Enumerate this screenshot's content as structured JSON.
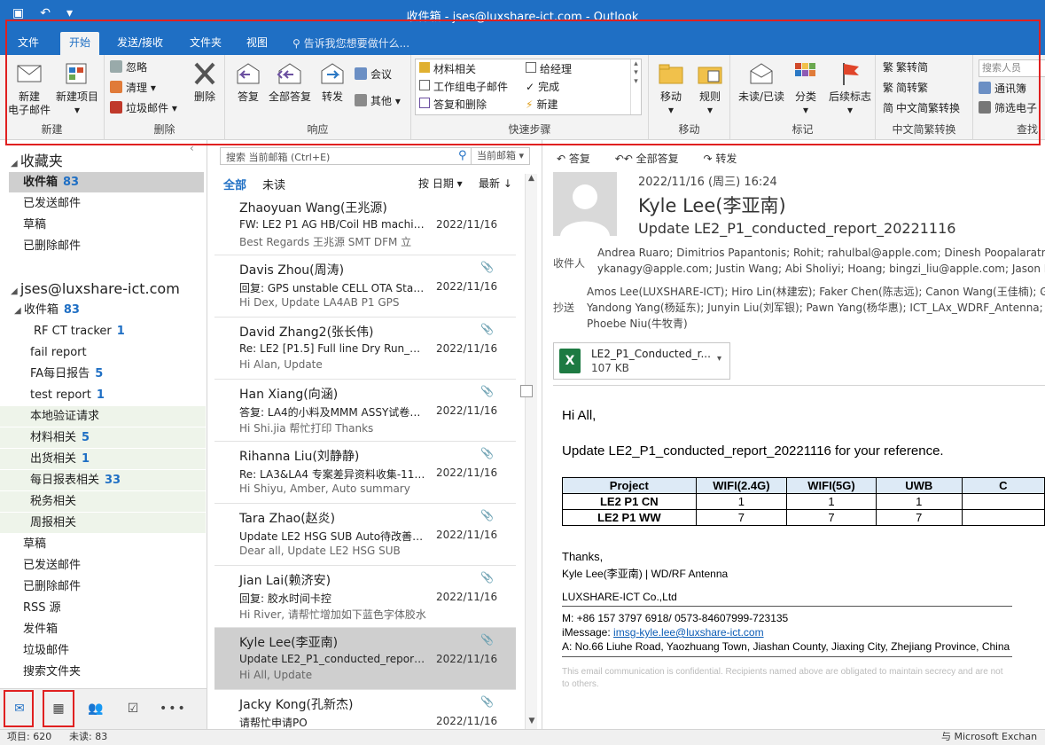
{
  "window": {
    "title": "收件箱 - jses@luxshare-ict.com - Outlook"
  },
  "menu": {
    "tabs": [
      "文件",
      "开始",
      "发送/接收",
      "文件夹",
      "视图"
    ],
    "tell_me": "告诉我您想要做什么..."
  },
  "ribbon": {
    "new_group": {
      "label": "新建",
      "new_email": "新建\n电子邮件",
      "new_items": "新建项目"
    },
    "delete_group": {
      "label": "删除",
      "ignore": "忽略",
      "cleanup": "清理",
      "junk": "垃圾邮件",
      "delete": "删除"
    },
    "respond_group": {
      "label": "响应",
      "reply": "答复",
      "reply_all": "全部答复",
      "forward": "转发",
      "meeting": "会议",
      "more": "其他"
    },
    "quick_steps": {
      "label": "快速步骤",
      "items": [
        "材料相关",
        "工作组电子邮件",
        "答复和删除",
        "给经理",
        "完成",
        "新建"
      ]
    },
    "move_group": {
      "label": "移动",
      "move": "移动",
      "rules": "规则"
    },
    "tags_group": {
      "label": "标记",
      "unread": "未读/已读",
      "categorize": "分类",
      "followup": "后续标志"
    },
    "convert_group": {
      "label": "中文简繁转换",
      "to_trad": "繁转简",
      "to_simp": "简转繁",
      "convert": "中文简繁转换"
    },
    "find_group": {
      "label": "查找",
      "search_people": "搜索人员",
      "address_book": "通讯簿",
      "filter": "筛选电子"
    }
  },
  "folders": {
    "favorites_header": "收藏夹",
    "favorites": [
      {
        "name": "收件箱",
        "count": "83"
      },
      {
        "name": "已发送邮件",
        "count": ""
      },
      {
        "name": "草稿",
        "count": ""
      },
      {
        "name": "已删除邮件",
        "count": ""
      }
    ],
    "account": "jses@luxshare-ict.com",
    "inbox": {
      "name": "收件箱",
      "count": "83"
    },
    "subfolders": [
      {
        "name": "RF CT tracker",
        "count": "1"
      },
      {
        "name": "fail report",
        "count": ""
      },
      {
        "name": "FA每日报告",
        "count": "5"
      },
      {
        "name": "test report",
        "count": "1"
      },
      {
        "name": "本地验证请求",
        "count": ""
      },
      {
        "name": "材料相关",
        "count": "5"
      },
      {
        "name": "出货相关",
        "count": "1"
      },
      {
        "name": "每日报表相关",
        "count": "33"
      },
      {
        "name": "税务相关",
        "count": ""
      },
      {
        "name": "周报相关",
        "count": ""
      }
    ],
    "others": [
      "草稿",
      "已发送邮件",
      "已删除邮件",
      "RSS 源",
      "发件箱",
      "垃圾邮件",
      "搜索文件夹"
    ]
  },
  "status": {
    "items": "项目: 620",
    "unread": "未读: 83",
    "server": "与 Microsoft Exchan"
  },
  "list": {
    "search_placeholder": "搜索 当前邮箱 (Ctrl+E)",
    "scope": "当前邮箱",
    "filter_all": "全部",
    "filter_unread": "未读",
    "sort_by": "按 日期",
    "order": "最新"
  },
  "messages": [
    {
      "from": "Zhaoyuan Wang(王兆源)",
      "subject": "FW: LE2 P1 AG HB/Coil HB machine...",
      "date": "2022/11/16",
      "preview": "Best Regards  王兆源  SMT DFM  立"
    },
    {
      "from": "Davis Zhou(周涛)",
      "subject": "回复: GPS unstable CELL OTA Statio...",
      "date": "2022/11/16",
      "preview": "Hi Dex,  Update LA4AB P1 GPS"
    },
    {
      "from": "David Zhang2(张长伟)",
      "subject": "Re: LE2 [P1.5] Full line Dry Run_221...",
      "date": "2022/11/16",
      "preview": "Hi Alan,  Update"
    },
    {
      "from": "Han Xiang(向涵)",
      "subject": "答复: LA4的小料及MMM ASSY试卷打...",
      "date": "2022/11/16",
      "preview": "Hi Shi.jia  帮忙打印  Thanks"
    },
    {
      "from": "Rihanna Liu(刘静静)",
      "subject": "Re: LA3&LA4 专案差异资料收集-11/16",
      "date": "2022/11/16",
      "preview": "Hi Shiyu, Amber,  Auto summary"
    },
    {
      "from": "Tara Zhao(赵炎)",
      "subject": "Update LE2 HSG SUB Auto待改善问...",
      "date": "2022/11/16",
      "preview": "Dear all,  Update LE2 HSG SUB"
    },
    {
      "from": "Jian Lai(赖济安)",
      "subject": "回复:  胶水时间卡控",
      "date": "2022/11/16",
      "preview": "Hi River,  请帮忙增加如下蓝色字体胶水"
    },
    {
      "from": "Kyle Lee(李亚南)",
      "subject": "Update LE2_P1_conducted_report_...",
      "date": "2022/11/16",
      "preview": "Hi All,  Update"
    },
    {
      "from": "Jacky Kong(孔新杰)",
      "subject": "请帮忙申请PO",
      "date": "2022/11/16",
      "preview": ""
    }
  ],
  "reading": {
    "actions": [
      "答复",
      "全部答复",
      "转发"
    ],
    "date": "2022/11/16 (周三) 16:24",
    "sender": "Kyle Lee(李亚南)",
    "subject": "Update LE2_P1_conducted_report_20221116",
    "to_label": "收件人",
    "to_line1": "Andrea Ruaro; Dimitrios Papantonis; Rohit; rahulbal@apple.com; Dinesh Poopalaratnam",
    "to_line2": "ykanagy@apple.com; Justin Wang; Abi Sholiyi; Hoang; bingzi_liu@apple.com; Jason Niu",
    "cc_label": "抄送",
    "cc_line1": "Amos Lee(LUXSHARE-ICT); Hiro Lin(林建宏); Faker Chen(陈志远); Canon Wang(王佳楠); Gez",
    "cc_line2": "Yandong Yang(杨延东); Junyin Liu(刘军银); Pawn Yang(杨华惠); ICT_LAx_WDRF_Antenna; IC",
    "cc_line3": "Phoebe Niu(牛牧青)",
    "attachment_name": "LE2_P1_Conducted_r...",
    "attachment_size": "107 KB",
    "greeting": "Hi All,",
    "body_line": "Update LE2_P1_conducted_report_20221116 for your reference.",
    "table": {
      "headers": [
        "Project",
        "WIFI(2.4G)",
        "WIFI(5G)",
        "UWB",
        "C"
      ],
      "rows": [
        [
          "LE2 P1 CN",
          "1",
          "1",
          "1",
          ""
        ],
        [
          "LE2 P1 WW",
          "7",
          "7",
          "7",
          ""
        ]
      ]
    },
    "thanks": "Thanks,",
    "sig_name": "Kyle Lee(李亚南) | WD/RF Antenna",
    "sig_company": "LUXSHARE-ICT Co.,Ltd",
    "sig_phone": "M: +86 157 3797 6918/ 0573-84607999-723135",
    "sig_imessage_label": "iMessage: ",
    "sig_imessage": "imsg-kyle.lee@luxshare-ict.com",
    "sig_address": "A: No.66 Liuhe Road, Yaozhuang Town, Jiashan County, Jiaxing City, Zhejiang Province, China",
    "disclaimer": "This email communication is confidential. Recipients named above are obligated to maintain secrecy and are not",
    "disclaimer2": "to others."
  }
}
